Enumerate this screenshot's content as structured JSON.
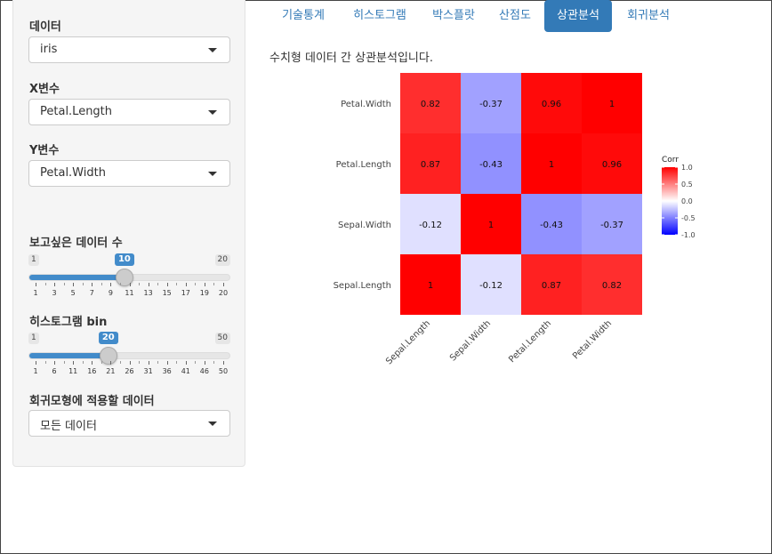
{
  "sidebar": {
    "data_label": "데이터",
    "data_value": "iris",
    "x_label": "X변수",
    "x_value": "Petal.Length",
    "y_label": "Y변수",
    "y_value": "Petal.Width",
    "n_label": "보고싶은 데이터 수",
    "n_slider": {
      "min": "1",
      "max": "20",
      "value": "10",
      "fraction": 0.4737,
      "tick_labels": [
        "1",
        "3",
        "5",
        "7",
        "9",
        "11",
        "13",
        "15",
        "17",
        "19",
        "20"
      ]
    },
    "bin_label": "히스토그램 bin",
    "bin_slider": {
      "min": "1",
      "max": "50",
      "value": "20",
      "fraction": 0.3878,
      "tick_labels": [
        "1",
        "6",
        "11",
        "16",
        "21",
        "26",
        "31",
        "36",
        "41",
        "46",
        "50"
      ]
    },
    "reg_label": "회귀모형에 적용할 데이터",
    "reg_value": "모든 데이터"
  },
  "tabs": [
    "기술통계",
    "히스토그램",
    "박스플랏",
    "산점도",
    "상관분석",
    "회귀분석"
  ],
  "active_tab": "상관분석",
  "description": "수치형 데이터 간 상관분석입니다.",
  "chart_data": {
    "type": "heatmap",
    "x_categories": [
      "Sepal.Length",
      "Sepal.Width",
      "Petal.Length",
      "Petal.Width"
    ],
    "y_categories": [
      "Petal.Width",
      "Petal.Length",
      "Sepal.Width",
      "Sepal.Length"
    ],
    "values": [
      [
        "0.82",
        "-0.37",
        "0.96",
        "1"
      ],
      [
        "0.87",
        "-0.43",
        "1",
        "0.96"
      ],
      [
        "-0.12",
        "1",
        "-0.43",
        "-0.37"
      ],
      [
        "1",
        "-0.12",
        "0.87",
        "0.82"
      ]
    ],
    "legend": {
      "title": "Corr",
      "ticks": [
        "1.0",
        "0.5",
        "0.0",
        "-0.5",
        "-1.0"
      ]
    },
    "colors": {
      "high": "#ff0000",
      "mid": "#ffffff",
      "low": "#0000ff"
    }
  }
}
